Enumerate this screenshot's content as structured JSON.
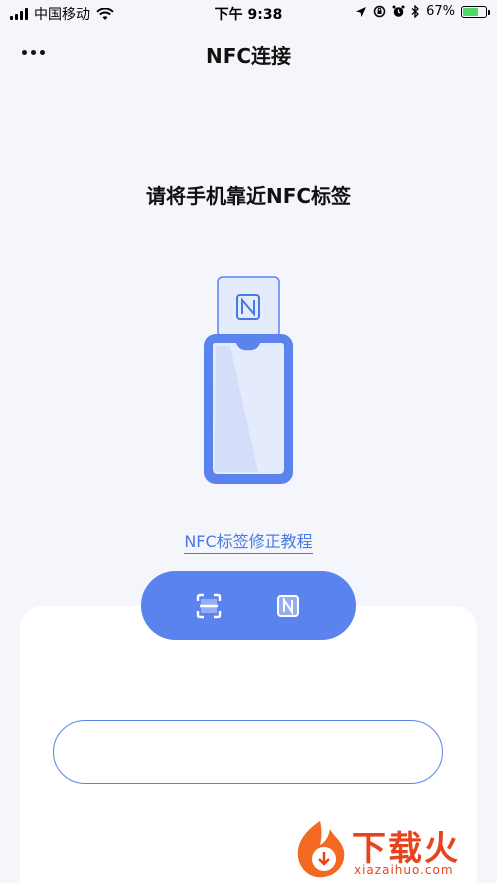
{
  "status_bar": {
    "carrier": "中国移动",
    "time": "下午 9:38",
    "battery_percent": "67%",
    "battery_level": 0.67,
    "icons": [
      "signal-icon",
      "wifi-icon",
      "location-icon",
      "orientation-lock-icon",
      "alarm-icon",
      "bluetooth-icon",
      "battery-icon"
    ]
  },
  "nav": {
    "title": "NFC连接",
    "more_icon": "more-dots-icon"
  },
  "main": {
    "prompt": "请将手机靠近NFC标签",
    "illustration_icon": "nfc-phone-card-icon",
    "tutorial_link": "NFC标签修正教程"
  },
  "mode_switch": {
    "scan_icon": "scan-icon",
    "nfc_icon": "nfc-icon"
  },
  "input": {
    "value": "",
    "placeholder": ""
  },
  "watermark": {
    "text": "下载火",
    "subtext": "xiazaihuo.com"
  },
  "colors": {
    "accent": "#5b83ee",
    "link": "#4a78e5",
    "background": "#f5f6fb",
    "watermark": "#e8431f"
  }
}
